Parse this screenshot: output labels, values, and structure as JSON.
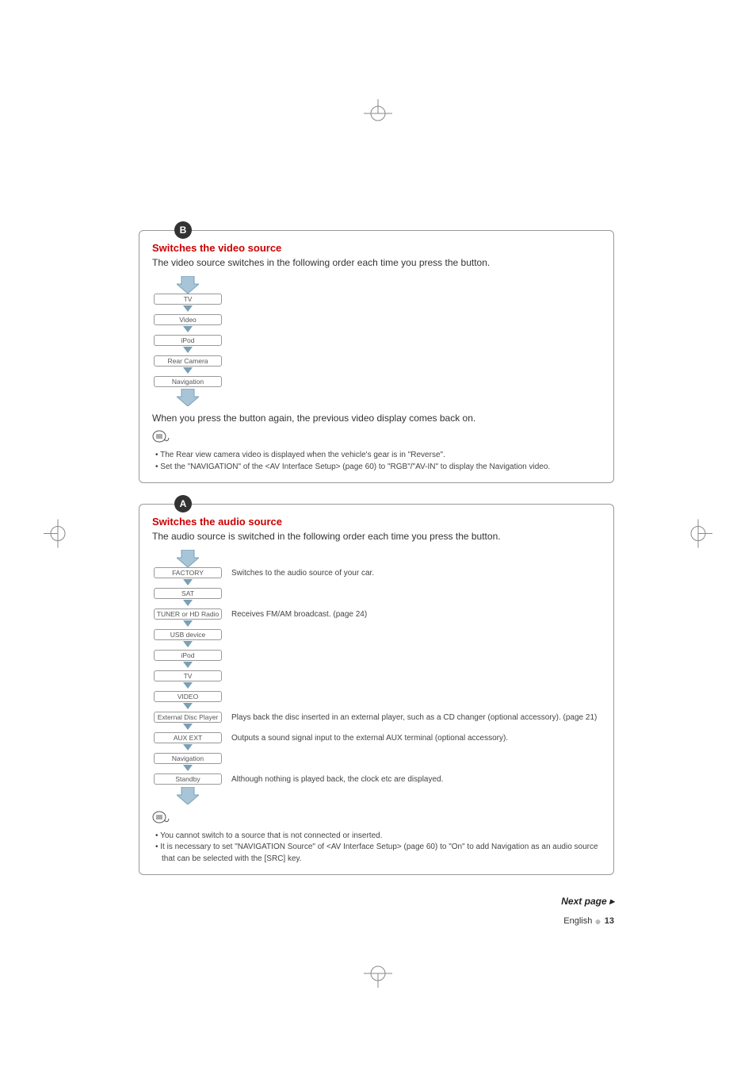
{
  "sectionB": {
    "badge": "B",
    "title": "Switches the video source",
    "subtitle": "The video source switches in the following order each time you press the button.",
    "items": [
      "TV",
      "Video",
      "iPod",
      "Rear Camera",
      "Navigation"
    ],
    "afterText": "When you press the button again, the previous video display comes back on.",
    "notes": [
      "The Rear view camera video is displayed when the vehicle's gear is in \"Reverse\".",
      "Set the \"NAVIGATION\" of the <AV Interface Setup> (page 60) to \"RGB\"/\"AV-IN\" to display the Navigation video."
    ]
  },
  "sectionA": {
    "badge": "A",
    "title": "Switches the audio source",
    "subtitle": "The audio source is switched in the following order each time you press the button.",
    "rows": [
      {
        "label": "FACTORY",
        "desc": "Switches to the audio source of your car."
      },
      {
        "label": "SAT",
        "desc": ""
      },
      {
        "label": "TUNER or HD Radio",
        "desc": "Receives FM/AM broadcast. (page 24)"
      },
      {
        "label": "USB device",
        "desc": ""
      },
      {
        "label": "iPod",
        "desc": ""
      },
      {
        "label": "TV",
        "desc": ""
      },
      {
        "label": "VIDEO",
        "desc": ""
      },
      {
        "label": "External Disc Player",
        "desc": "Plays back the disc inserted in an external player, such as a CD changer (optional accessory). (page 21)"
      },
      {
        "label": "AUX EXT",
        "desc": "Outputs a sound signal input to the external AUX terminal (optional accessory)."
      },
      {
        "label": "Navigation",
        "desc": ""
      },
      {
        "label": "Standby",
        "desc": "Although nothing is played back, the clock etc are displayed."
      }
    ],
    "notes": [
      "You cannot switch to a source that is not connected or inserted.",
      "It is necessary to set \"NAVIGATION Source\" of <AV Interface Setup> (page 60) to \"On\" to add Navigation as an audio source that can be selected with the [SRC] key."
    ]
  },
  "nextPage": "Next page",
  "footer": {
    "language": "English",
    "page": "13"
  }
}
